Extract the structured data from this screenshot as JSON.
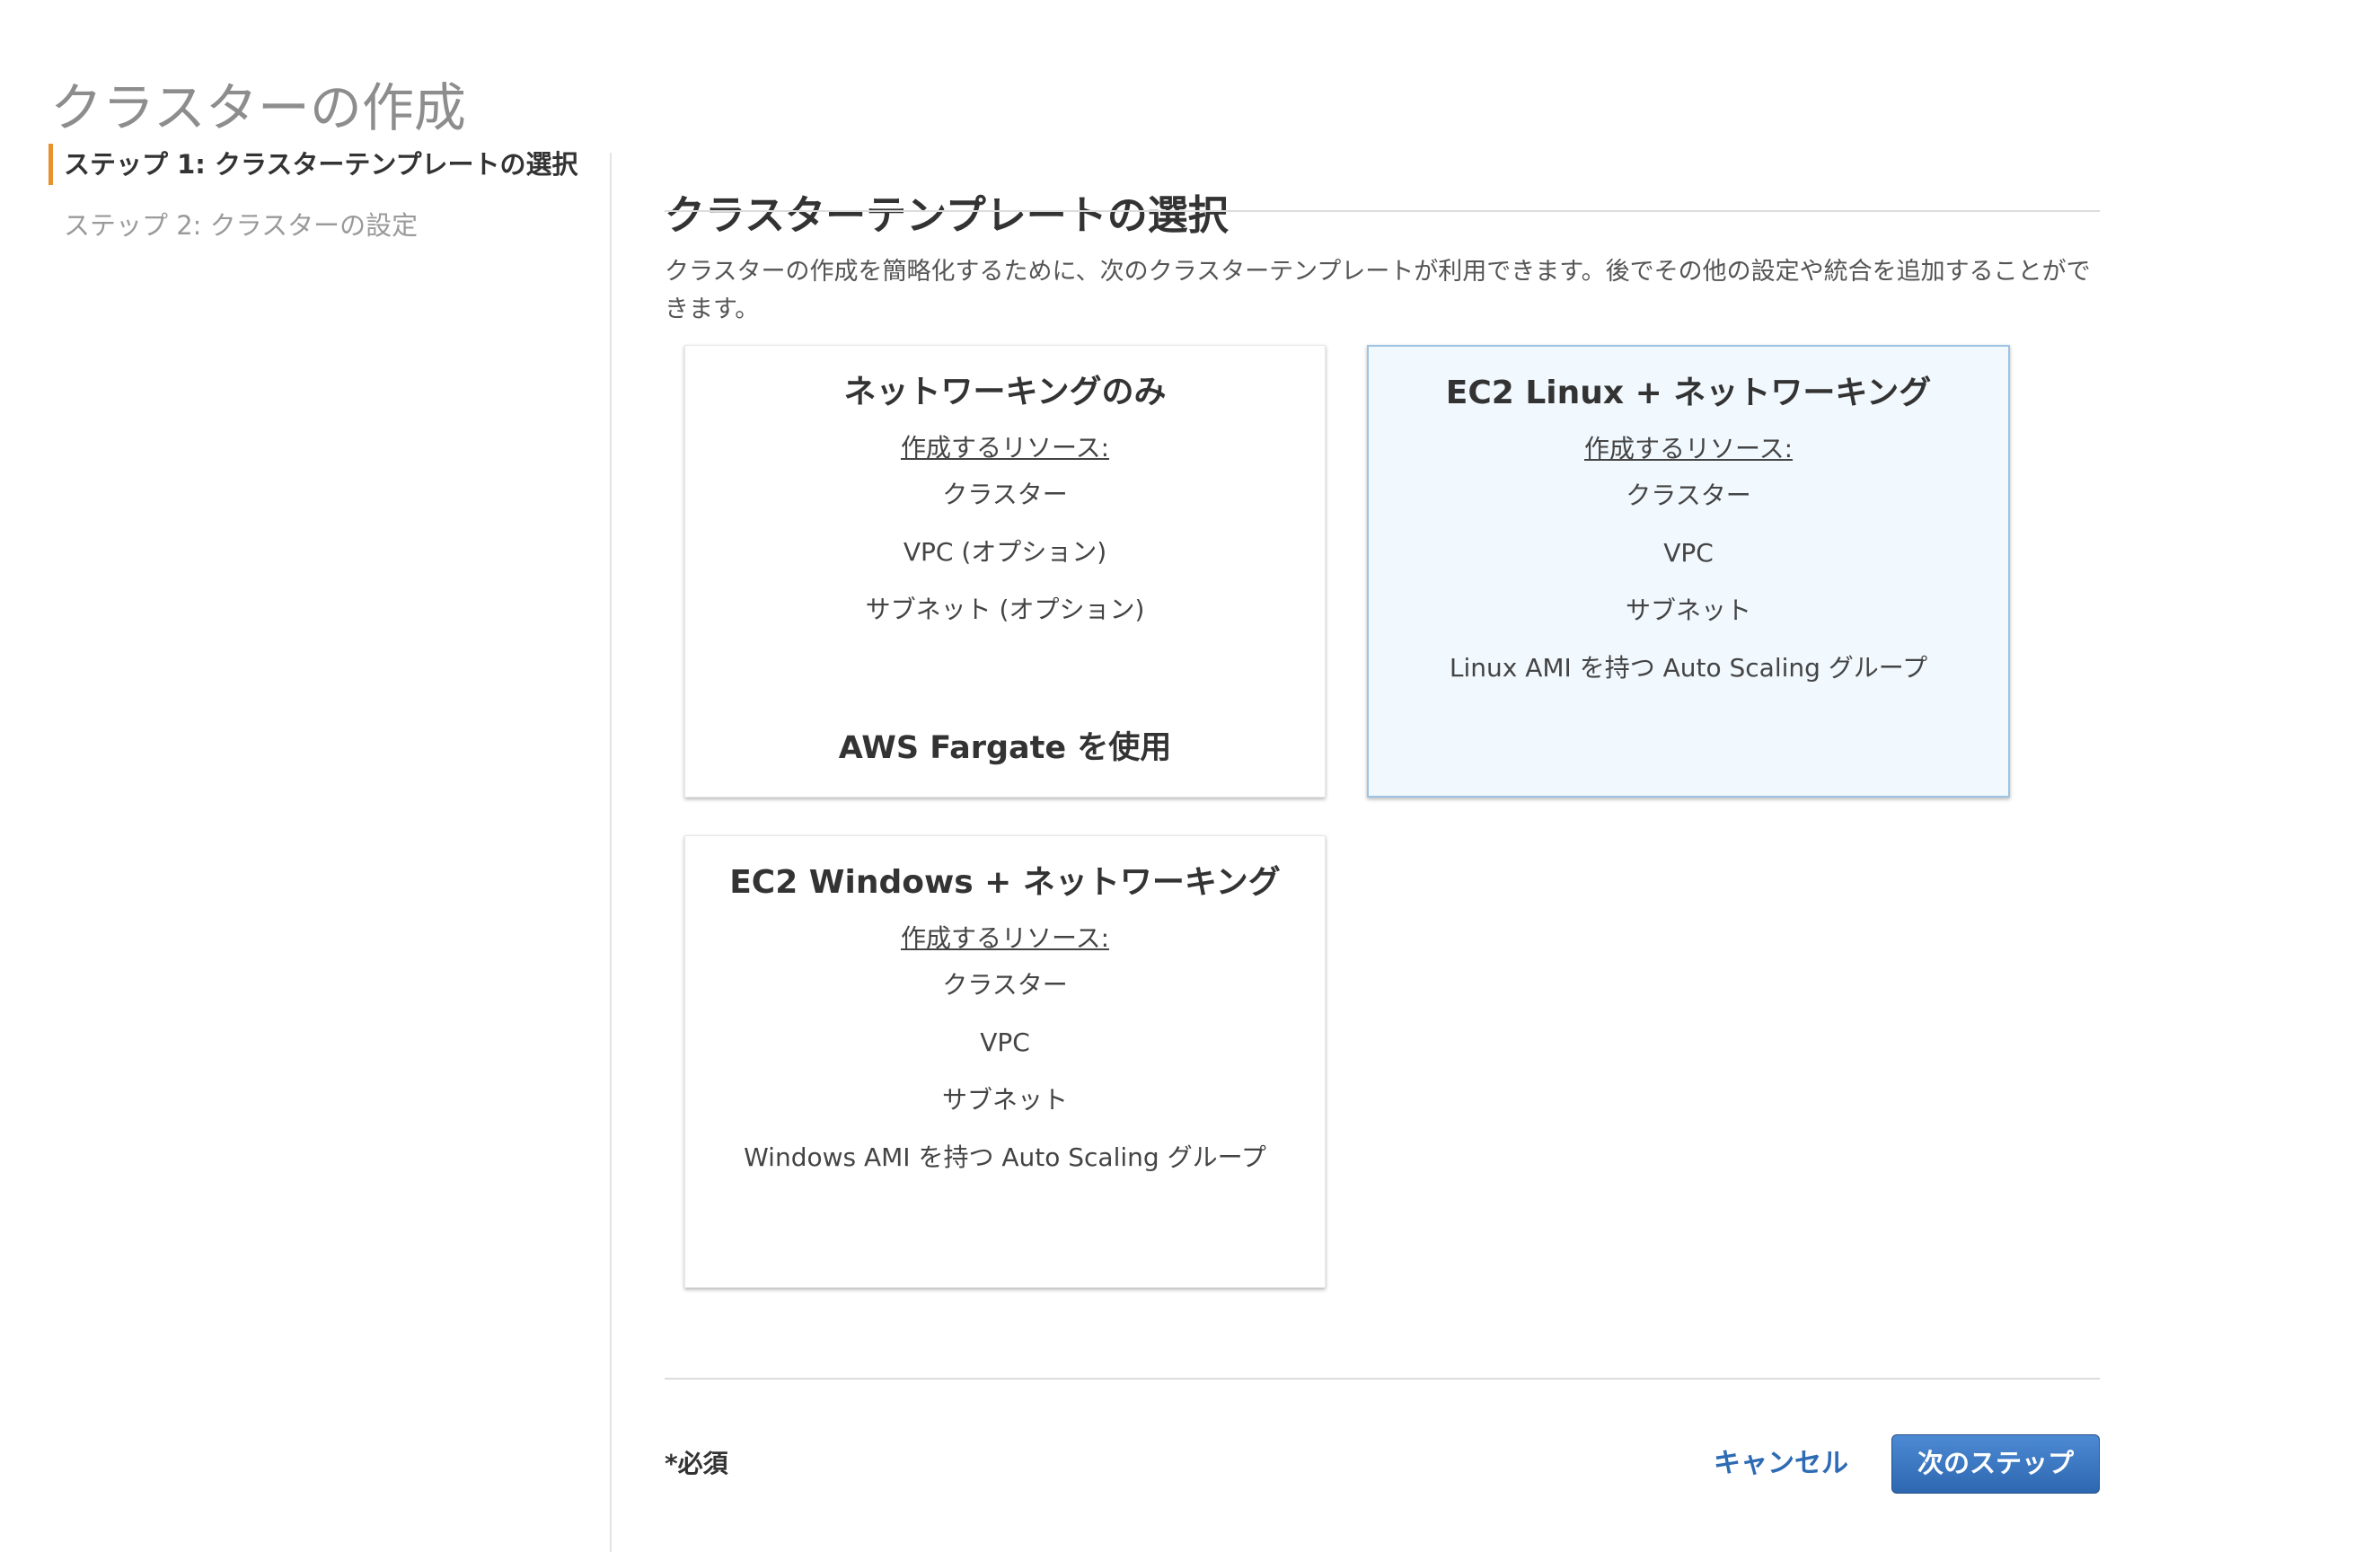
{
  "page": {
    "title": "クラスターの作成"
  },
  "sidebar": {
    "steps": [
      {
        "label": "ステップ 1: クラスターテンプレートの選択",
        "active": true
      },
      {
        "label": "ステップ 2: クラスターの設定",
        "active": false
      }
    ]
  },
  "main": {
    "section_title": "クラスターテンプレートの選択",
    "description": "クラスターの作成を簡略化するために、次のクラスターテンプレートが利用できます。後でその他の設定や統合を追加することができます。",
    "templates": [
      {
        "title": "ネットワーキングのみ",
        "resources_label": "作成するリソース:",
        "resources": [
          "クラスター",
          "VPC (オプション)",
          "サブネット (オプション)"
        ],
        "footer": "AWS Fargate を使用",
        "selected": false
      },
      {
        "title": "EC2 Linux + ネットワーキング",
        "resources_label": "作成するリソース:",
        "resources": [
          "クラスター",
          "VPC",
          "サブネット",
          "Linux AMI を持つ Auto Scaling グループ"
        ],
        "footer": "",
        "selected": true
      },
      {
        "title": "EC2 Windows + ネットワーキング",
        "resources_label": "作成するリソース:",
        "resources": [
          "クラスター",
          "VPC",
          "サブネット",
          "Windows AMI を持つ Auto Scaling グループ"
        ],
        "footer": "",
        "selected": false
      }
    ]
  },
  "footer": {
    "required_note": "*必須",
    "cancel_label": "キャンセル",
    "next_label": "次のステップ"
  },
  "colors": {
    "accent_step": "#e7912f",
    "primary_button": "#2d67b0",
    "link": "#2d6bb5",
    "selected_card_bg": "#f1f8fe",
    "selected_card_border": "#9ec3e4"
  }
}
